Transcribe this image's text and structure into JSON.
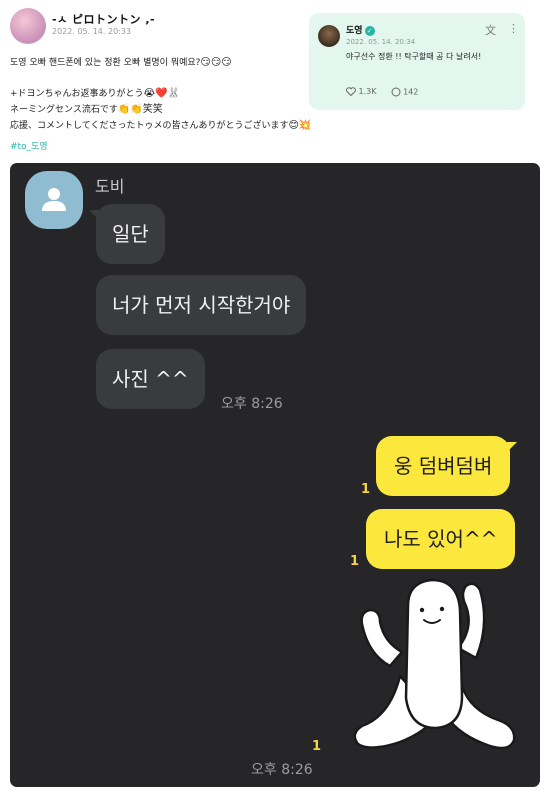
{
  "post": {
    "author": "-ㅅ ピロトントン ,-",
    "date": "2022. 05. 14. 20:33",
    "lines": [
      "도영 오빠 핸드폰에 있는 정환 오빠 별명이 뭐예요?",
      "",
      "+ドヨンちゃんお返事ありがとう",
      "ネーミングセンス流石です",
      "応援、コメントしてくださったトゥメの皆さんありがとうございます"
    ],
    "line_emojis": [
      "😏😏😏",
      "",
      "😭❤️🐰",
      "👏👏笑笑",
      "😊💥"
    ],
    "hashtag": "#to_도영"
  },
  "quoted_post": {
    "name": "도영",
    "verified_icon": "verified-badge-icon",
    "date": "2022. 05. 14. 20:34",
    "text": "야구선수 정환 !! 탁구할때 공 다 날려서!",
    "likes": "1.3K",
    "comments": "142",
    "icons": [
      "translate-icon",
      "more-icon",
      "heart-icon",
      "comment-icon"
    ]
  },
  "chat": {
    "sender": "도비",
    "received": [
      "일단",
      "너가 먼저 시작한거야",
      "사진 ^^"
    ],
    "received_time": "오후 8:26",
    "sent": [
      "웅 덤벼덤벼",
      "나도 있어^^"
    ],
    "unread_marks": [
      "1",
      "1",
      "1"
    ],
    "sent_time": "오후 8:26",
    "colors": {
      "background": "#262628",
      "received_bubble": "#3a3b3d",
      "sent_bubble": "#fce83c",
      "unread": "#f5d442",
      "hashtag": "#27b3a5"
    }
  }
}
